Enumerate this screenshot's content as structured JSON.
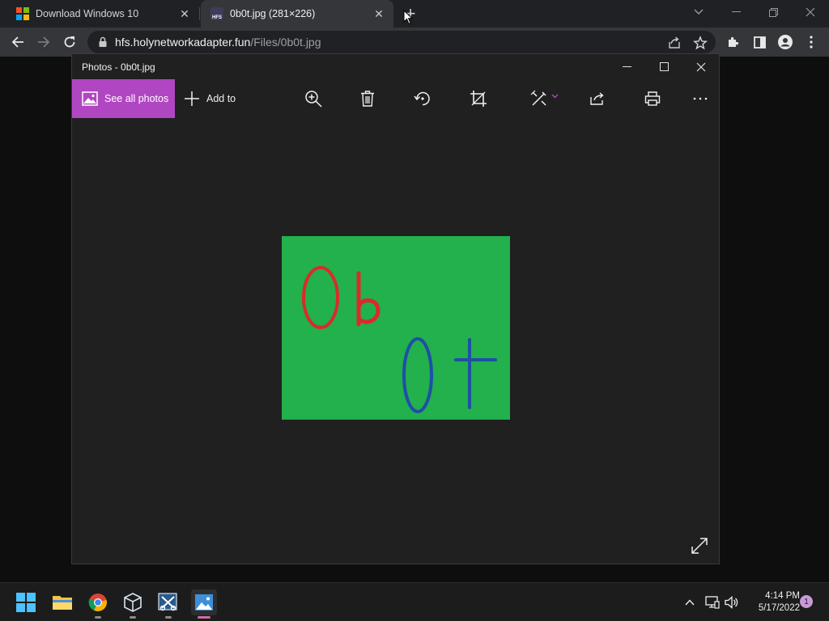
{
  "browser": {
    "tabs": [
      {
        "title": "Download Windows 10",
        "favicon": "windows-logo-icon"
      },
      {
        "title": "0b0t.jpg (281×226)",
        "favicon": "hfs-icon",
        "favicon_text": "HFS"
      }
    ],
    "address": {
      "host": "hfs.holynetworkadapter.fun",
      "path": "/Files/0b0t.jpg"
    }
  },
  "photos": {
    "window_title": "Photos - 0b0t.jpg",
    "see_all_label": "See all photos",
    "add_to_label": "Add to",
    "accent_color": "#b146c2",
    "image": {
      "background": "#22b14c",
      "text_line1": "0b",
      "text_line1_color": "#d92b2b",
      "text_line2": "0t",
      "text_line2_color": "#1f4fa8"
    }
  },
  "taskbar": {
    "time": "4:14 PM",
    "date": "5/17/2022",
    "notification_count": "1"
  }
}
